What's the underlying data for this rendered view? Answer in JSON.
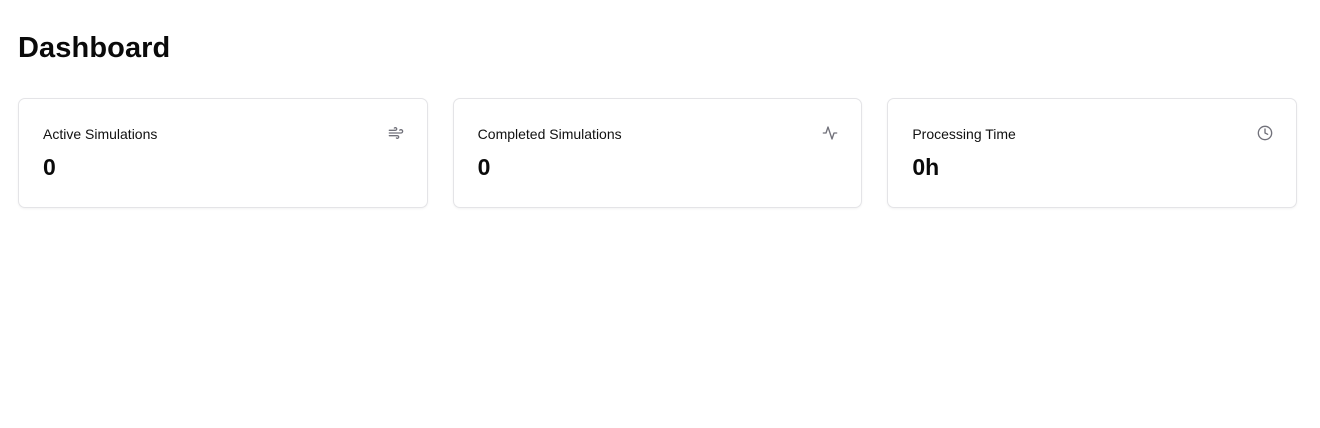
{
  "header": {
    "title": "Dashboard"
  },
  "stats": [
    {
      "label": "Active Simulations",
      "value": "0",
      "icon": "wind-icon"
    },
    {
      "label": "Completed Simulations",
      "value": "0",
      "icon": "activity-icon"
    },
    {
      "label": "Processing Time",
      "value": "0h",
      "icon": "clock-icon"
    }
  ],
  "colors": {
    "text": "#0a0a0a",
    "muted_icon": "#71717a",
    "card_border": "#e4e4e7",
    "background": "#ffffff"
  }
}
